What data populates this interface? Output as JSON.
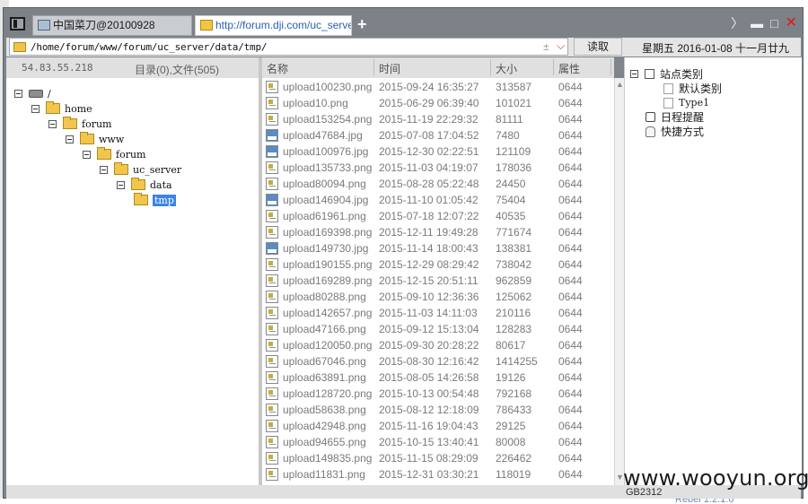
{
  "tabs": [
    {
      "label": "中国菜刀@20100928"
    },
    {
      "label": "http://forum.dji.com/uc_serve..."
    }
  ],
  "new_tab_label": "+",
  "window_controls": {
    "more": "〉",
    "minimize": "▬",
    "maximize": "□",
    "close": "✕"
  },
  "toolbar": {
    "path": "/home/forum/www/forum/uc_server/data/tmp/",
    "star": "±",
    "dropdown": "⌵",
    "read_label": "读取",
    "date": "星期五 2016-01-08 十一月廿九"
  },
  "left_header": {
    "ip": "54.83.55.218",
    "summary": "目录(0),文件(505)"
  },
  "tree": [
    {
      "label": "/",
      "icon": "drive-icon"
    },
    {
      "label": "home",
      "icon": "folder-icon"
    },
    {
      "label": "forum",
      "icon": "folder-icon"
    },
    {
      "label": "www",
      "icon": "folder-icon"
    },
    {
      "label": "forum",
      "icon": "folder-icon"
    },
    {
      "label": "uc_server",
      "icon": "folder-icon"
    },
    {
      "label": "data",
      "icon": "folder-icon"
    },
    {
      "label": "tmp",
      "icon": "folder-open-icon",
      "selected": true
    }
  ],
  "file_columns": {
    "name": "名称",
    "time": "时间",
    "size": "大小",
    "attr": "属性"
  },
  "files": [
    {
      "name": "upload100230.png",
      "time": "2015-09-24 16:35:27",
      "size": "313587",
      "attr": "0644",
      "type": "png"
    },
    {
      "name": "upload10.png",
      "time": "2015-06-29 06:39:40",
      "size": "101021",
      "attr": "0644",
      "type": "png"
    },
    {
      "name": "upload153254.png",
      "time": "2015-11-19 22:29:32",
      "size": "81111",
      "attr": "0644",
      "type": "png"
    },
    {
      "name": "upload47684.jpg",
      "time": "2015-07-08 17:04:52",
      "size": "7480",
      "attr": "0644",
      "type": "jpg"
    },
    {
      "name": "upload100976.jpg",
      "time": "2015-12-30 02:22:51",
      "size": "121109",
      "attr": "0644",
      "type": "jpg"
    },
    {
      "name": "upload135733.png",
      "time": "2015-11-03 04:19:07",
      "size": "178036",
      "attr": "0644",
      "type": "png"
    },
    {
      "name": "upload80094.png",
      "time": "2015-08-28 05:22:48",
      "size": "24450",
      "attr": "0644",
      "type": "png"
    },
    {
      "name": "upload146904.jpg",
      "time": "2015-11-10 01:05:42",
      "size": "75404",
      "attr": "0644",
      "type": "jpg"
    },
    {
      "name": "upload61961.png",
      "time": "2015-07-18 12:07:22",
      "size": "40535",
      "attr": "0644",
      "type": "png"
    },
    {
      "name": "upload169398.png",
      "time": "2015-12-11 19:49:28",
      "size": "771674",
      "attr": "0644",
      "type": "png"
    },
    {
      "name": "upload149730.jpg",
      "time": "2015-11-14 18:00:43",
      "size": "138381",
      "attr": "0644",
      "type": "jpg"
    },
    {
      "name": "upload190155.png",
      "time": "2015-12-29 08:29:42",
      "size": "738042",
      "attr": "0644",
      "type": "png"
    },
    {
      "name": "upload169289.png",
      "time": "2015-12-15 20:51:11",
      "size": "962859",
      "attr": "0644",
      "type": "png"
    },
    {
      "name": "upload80288.png",
      "time": "2015-09-10 12:36:36",
      "size": "125062",
      "attr": "0644",
      "type": "png"
    },
    {
      "name": "upload142657.png",
      "time": "2015-11-03 14:11:03",
      "size": "210116",
      "attr": "0644",
      "type": "png"
    },
    {
      "name": "upload47166.png",
      "time": "2015-09-12 15:13:04",
      "size": "128283",
      "attr": "0644",
      "type": "png"
    },
    {
      "name": "upload120050.png",
      "time": "2015-09-30 20:28:22",
      "size": "80617",
      "attr": "0644",
      "type": "png"
    },
    {
      "name": "upload67046.png",
      "time": "2015-08-30 12:16:42",
      "size": "1414255",
      "attr": "0644",
      "type": "png"
    },
    {
      "name": "upload63891.png",
      "time": "2015-08-05 14:26:58",
      "size": "19126",
      "attr": "0644",
      "type": "png"
    },
    {
      "name": "upload128720.png",
      "time": "2015-10-13 00:54:48",
      "size": "792168",
      "attr": "0644",
      "type": "png"
    },
    {
      "name": "upload58638.png",
      "time": "2015-08-12 12:18:09",
      "size": "786433",
      "attr": "0644",
      "type": "png"
    },
    {
      "name": "upload42948.png",
      "time": "2015-11-16 19:04:43",
      "size": "29125",
      "attr": "0644",
      "type": "png"
    },
    {
      "name": "upload94655.png",
      "time": "2015-10-15 13:40:41",
      "size": "80008",
      "attr": "0644",
      "type": "png"
    },
    {
      "name": "upload149835.png",
      "time": "2015-11-15 08:29:09",
      "size": "226462",
      "attr": "0644",
      "type": "png"
    },
    {
      "name": "upload11831.png",
      "time": "2015-12-31 03:30:21",
      "size": "118019",
      "attr": "0644",
      "type": "png"
    }
  ],
  "right_panel": [
    {
      "label": "站点类别",
      "icon": "checkbox-icon",
      "level": 0
    },
    {
      "label": "默认类别",
      "icon": "document-icon",
      "level": 1
    },
    {
      "label": "Type1",
      "icon": "document-icon",
      "level": 1
    },
    {
      "label": "日程提醒",
      "icon": "calendar-icon",
      "level": 0
    },
    {
      "label": "快捷方式",
      "icon": "hand-icon",
      "level": 0
    }
  ],
  "status": {
    "encoding": "GB2312"
  },
  "watermark": "www.wooyun.org",
  "background_text": "Rebel 1.2.1.0",
  "colors": {
    "window_frame": "#7f858b",
    "selection": "#3a84e6",
    "tab_active_text": "#2a5fb8",
    "close": "#e01818"
  }
}
